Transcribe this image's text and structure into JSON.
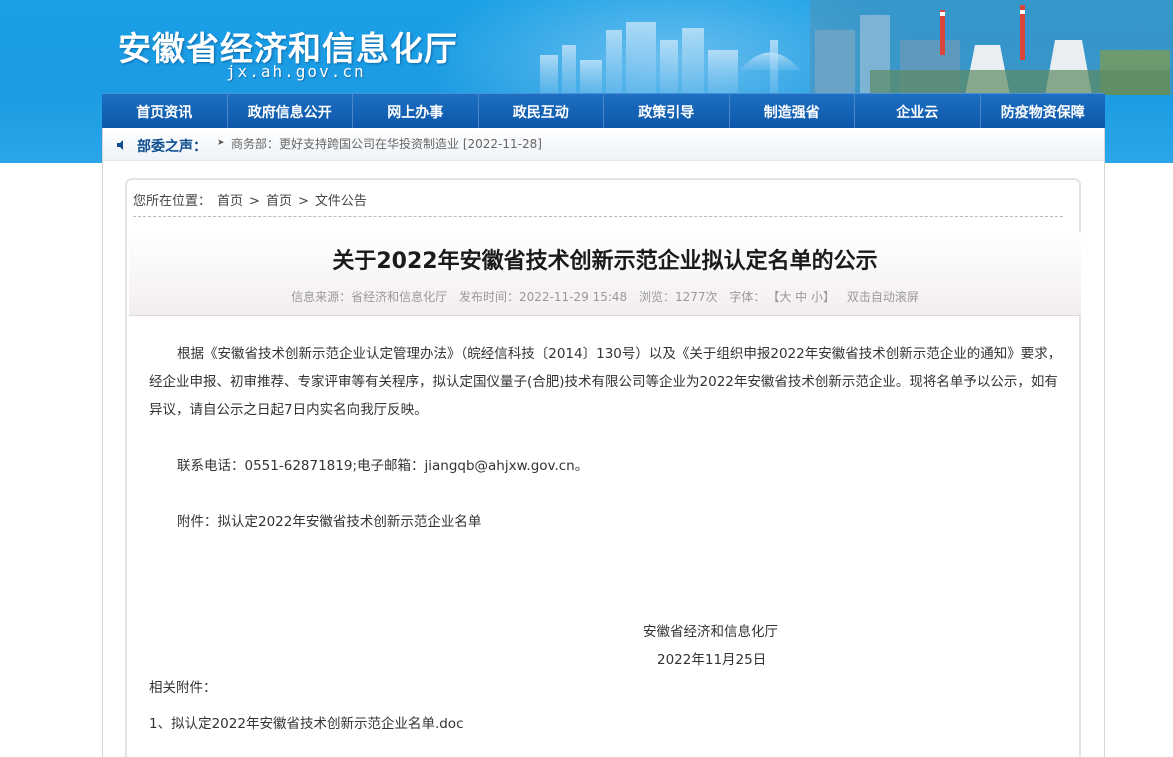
{
  "header": {
    "title": "安徽省经济和信息化厅",
    "domain": "jx.ah.gov.cn"
  },
  "nav": [
    {
      "label": "首页资讯"
    },
    {
      "label": "政府信息公开"
    },
    {
      "label": "网上办事"
    },
    {
      "label": "政民互动"
    },
    {
      "label": "政策引导"
    },
    {
      "label": "制造强省"
    },
    {
      "label": "企业云"
    },
    {
      "label": "防疫物资保障"
    }
  ],
  "ticker": {
    "label": "部委之声：",
    "text": "商务部：更好支持跨国公司在华投资制造业 [2022-11-28]"
  },
  "breadcrumb": {
    "prefix": "您所在位置：",
    "items": [
      "首页",
      "首页",
      "文件公告"
    ],
    "separator": ">"
  },
  "article": {
    "title": "关于2022年安徽省技术创新示范企业拟认定名单的公示",
    "meta": {
      "source": "信息来源：省经济和信息化厅",
      "time": "发布时间：2022-11-29 15:48",
      "views": "浏览：1277次",
      "font_label": "字体：",
      "font_sizes": "【大 中 小】",
      "auto_scroll": "双击自动滚屏"
    },
    "paragraphs": [
      "根据《安徽省技术创新示范企业认定管理办法》（皖经信科技〔2014〕130号）以及《关于组织申报2022年安徽省技术创新示范企业的通知》要求，经企业申报、初审推荐、专家评审等有关程序，拟认定国仪量子(合肥)技术有限公司等企业为2022年安徽省技术创新示范企业。现将名单予以公示，如有异议，请自公示之日起7日内实名向我厅反映。",
      "联系电话：0551-62871819;电子邮箱：jiangqb@ahjxw.gov.cn。",
      "附件：拟认定2022年安徽省技术创新示范企业名单"
    ],
    "signature_org": "安徽省经济和信息化厅",
    "signature_date": "2022年11月25日",
    "related_label": "相关附件：",
    "related_items": [
      "1、拟认定2022年安徽省技术创新示范企业名单.doc"
    ]
  }
}
